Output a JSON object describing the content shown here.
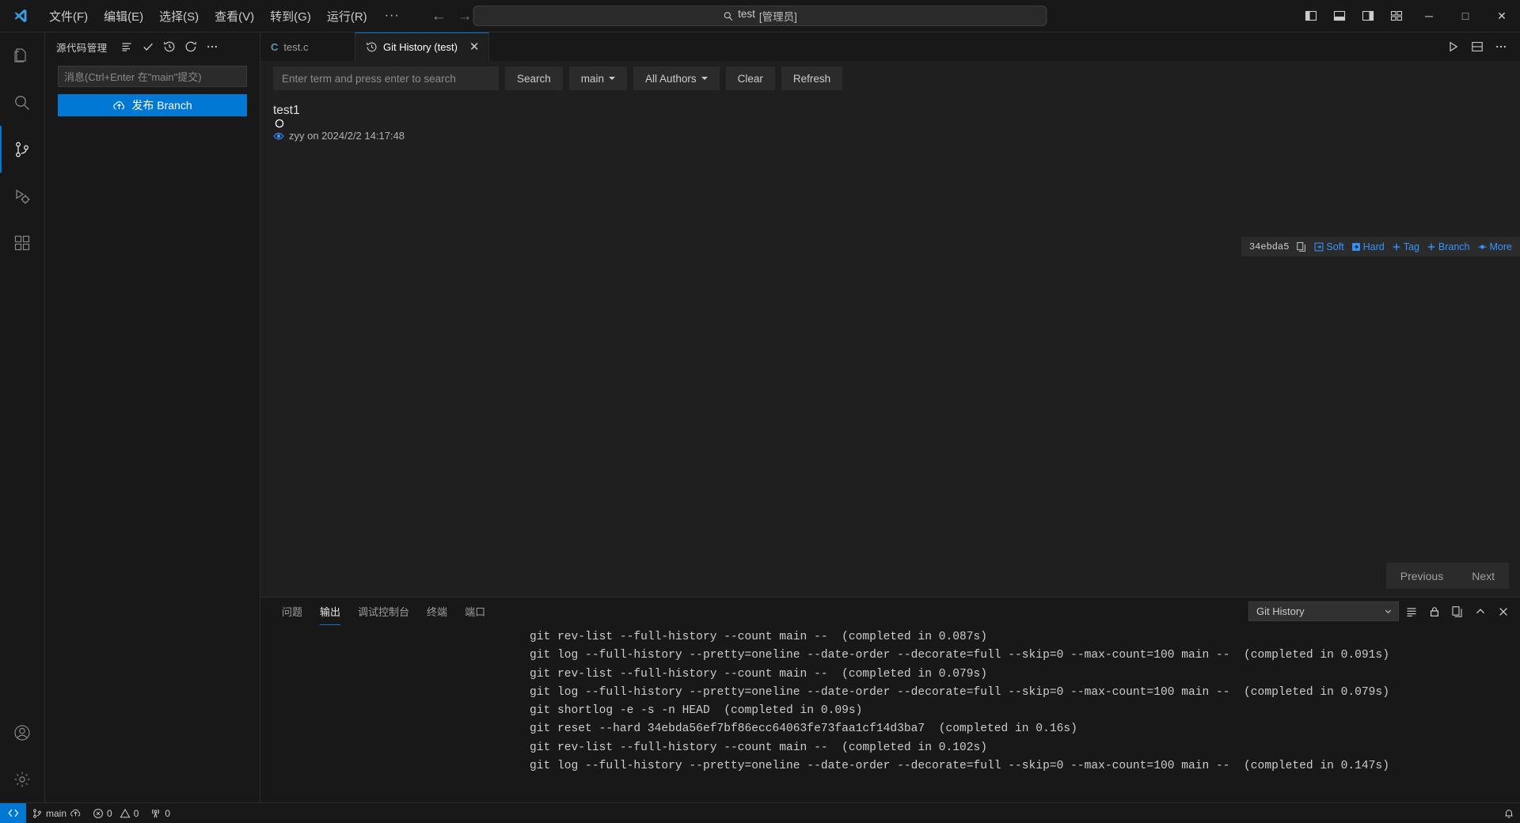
{
  "titlebar": {
    "menus": [
      "文件(F)",
      "编辑(E)",
      "选择(S)",
      "查看(V)",
      "转到(G)",
      "运行(R)"
    ],
    "more": "···",
    "back_arrow": "←",
    "forward_arrow": "→",
    "command_center": {
      "search_icon": "search-icon",
      "title": "test",
      "admin": "[管理员]"
    },
    "window_controls": {
      "minimize": "─",
      "maximize": "□",
      "close": "✕"
    }
  },
  "activitybar": {
    "items": [
      {
        "name": "explorer",
        "icon": "files-icon"
      },
      {
        "name": "search",
        "icon": "search-icon"
      },
      {
        "name": "source-control",
        "icon": "source-control-icon",
        "active": true
      },
      {
        "name": "run-and-debug",
        "icon": "run-debug-icon"
      },
      {
        "name": "extensions",
        "icon": "extensions-icon"
      }
    ],
    "bottom": [
      {
        "name": "accounts",
        "icon": "account-icon"
      },
      {
        "name": "manage",
        "icon": "gear-icon"
      }
    ]
  },
  "sidebar": {
    "title": "源代码管理",
    "actions": [
      "view-and-sort-icon",
      "commit-check-icon",
      "history-icon",
      "refresh-icon",
      "more-actions-icon"
    ],
    "commit_input_placeholder": "消息(Ctrl+Enter 在\"main\"提交)",
    "publish_button": "发布 Branch",
    "publish_icon": "cloud-upload-icon"
  },
  "tabs": [
    {
      "label": "test.c",
      "icon": "c-file-icon",
      "active": false
    },
    {
      "label": "Git History (test)",
      "icon": "history-icon",
      "active": true,
      "close": "✕"
    }
  ],
  "editor_actions": [
    "run-icon",
    "split-editor-icon",
    "more-actions-icon"
  ],
  "git_history": {
    "search_placeholder": "Enter term and press enter to search",
    "buttons": {
      "search": "Search",
      "branch": "main",
      "authors": "All Authors",
      "clear": "Clear",
      "refresh": "Refresh"
    },
    "commits": [
      {
        "subject": "test1",
        "author": "zyy",
        "meta": "zyy on 2024/2/2 14:17:48",
        "hash": "34ebda5",
        "actions": [
          "Soft",
          "Hard",
          "Tag",
          "Branch",
          "More"
        ]
      }
    ],
    "pager": {
      "previous": "Previous",
      "next": "Next"
    }
  },
  "panel": {
    "tabs": [
      "问题",
      "输出",
      "调试控制台",
      "终端",
      "端口"
    ],
    "active_tab": "输出",
    "output_channel": "Git History",
    "actions": [
      "clear-output-icon",
      "lock-scroll-icon",
      "open-editor-icon",
      "maximize-panel-icon",
      "close-panel-icon"
    ],
    "log_lines": [
      "git rev-list --full-history --count main --  (completed in 0.087s)",
      "git log --full-history --pretty=oneline --date-order --decorate=full --skip=0 --max-count=100 main --  (completed in 0.091s)",
      "git rev-list --full-history --count main --  (completed in 0.079s)",
      "git log --full-history --pretty=oneline --date-order --decorate=full --skip=0 --max-count=100 main --  (completed in 0.079s)",
      "git shortlog -e -s -n HEAD  (completed in 0.09s)",
      "git reset --hard 34ebda56ef7bf86ecc64063fe73faa1cf14d3ba7  (completed in 0.16s)",
      "git rev-list --full-history --count main --  (completed in 0.102s)",
      "git log --full-history --pretty=oneline --date-order --decorate=full --skip=0 --max-count=100 main --  (completed in 0.147s)"
    ]
  },
  "statusbar": {
    "remote_icon": "remote-window-icon",
    "branch": "main",
    "sync_icon": "cloud-sync-icon",
    "errors": "0",
    "warnings": "0",
    "ports": "0",
    "bell_icon": "bell-icon"
  },
  "colors": {
    "accent": "#0078d4",
    "link": "#3794ff",
    "background": "#1f1f1f",
    "chrome": "#181818"
  }
}
